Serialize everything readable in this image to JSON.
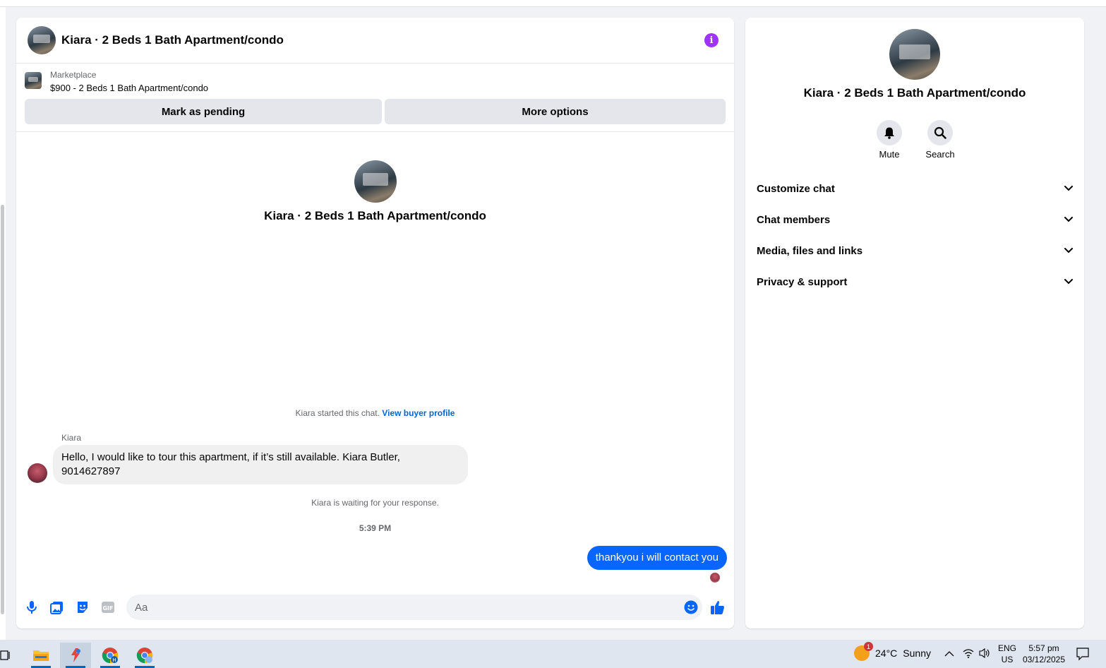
{
  "chat": {
    "title": "Kiara · 2 Beds 1 Bath Apartment/condo",
    "marketplace": {
      "label": "Marketplace",
      "item": "$900 - 2 Beds 1 Bath Apartment/condo",
      "mark_pending_label": "Mark as pending",
      "more_options_label": "More options"
    },
    "profile_name": "Kiara · 2 Beds 1 Bath Apartment/condo",
    "started_text": "Kiara started this chat.",
    "view_buyer_profile_label": "View buyer profile",
    "incoming": {
      "sender": "Kiara",
      "text": "Hello, I would like to tour this apartment, if it’s still available. Kiara Butler, 9014627897"
    },
    "waiting_text": "Kiara is waiting for your response.",
    "timestamp": "5:39 PM",
    "outgoing": {
      "text": "thankyou i will contact you"
    },
    "composer": {
      "placeholder": "Aa"
    }
  },
  "details": {
    "name": "Kiara · 2 Beds 1 Bath Apartment/condo",
    "actions": [
      {
        "label": "Mute",
        "icon": "bell-icon"
      },
      {
        "label": "Search",
        "icon": "search-icon"
      }
    ],
    "sections": [
      {
        "label": "Customize chat"
      },
      {
        "label": "Chat members"
      },
      {
        "label": "Media, files and links"
      },
      {
        "label": "Privacy & support"
      }
    ]
  },
  "taskbar": {
    "weather_temp": "24°C",
    "weather_desc": "Sunny",
    "weather_badge": "1",
    "lang_primary": "ENG",
    "lang_region": "US",
    "time": "5:57 pm",
    "date": "03/12/2025"
  },
  "colors": {
    "accent_blue": "#0866ff",
    "info_purple": "#a033ff",
    "link_blue": "#0064d1"
  }
}
